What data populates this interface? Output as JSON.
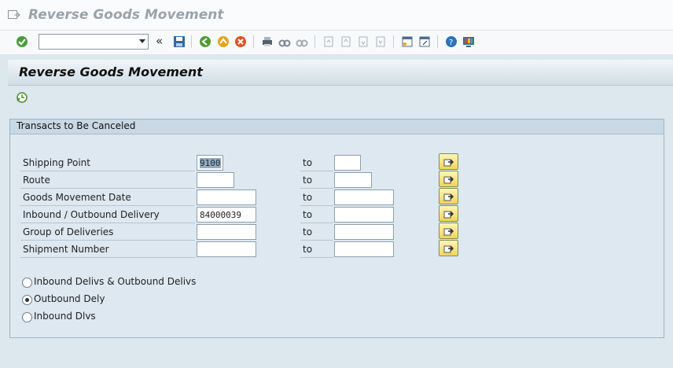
{
  "window": {
    "title": "Reverse Goods Movement"
  },
  "toolbar": {
    "command_value": "",
    "icons": [
      "enter-icon",
      "command-dropdown-icon",
      "chevron-left-icon",
      "save-icon",
      "back-icon",
      "exit-icon",
      "cancel-icon",
      "print-icon",
      "find-icon",
      "find-next-icon",
      "first-page-icon",
      "previous-page-icon",
      "next-page-icon",
      "last-page-icon",
      "new-session-icon",
      "shortcut-icon",
      "help-icon",
      "customize-layout-icon"
    ]
  },
  "screen": {
    "title": "Reverse Goods Movement",
    "execute_icon": "execute-icon"
  },
  "selection_block": {
    "title": "Transacts to Be Canceled",
    "to_label": "to",
    "rows": [
      {
        "label": "Shipping Point",
        "from": "9100",
        "to": ""
      },
      {
        "label": "Route",
        "from": "",
        "to": ""
      },
      {
        "label": "Goods Movement Date",
        "from": "",
        "to": ""
      },
      {
        "label": "Inbound / Outbound Delivery",
        "from": "84000039",
        "to": ""
      },
      {
        "label": "Group of Deliveries",
        "from": "",
        "to": ""
      },
      {
        "label": "Shipment Number",
        "from": "",
        "to": ""
      }
    ]
  },
  "options": [
    {
      "label": "Inbound Delivs & Outbound Delivs",
      "selected": false
    },
    {
      "label": "Outbound Dely",
      "selected": true
    },
    {
      "label": "Inbound Dlvs",
      "selected": false
    }
  ]
}
